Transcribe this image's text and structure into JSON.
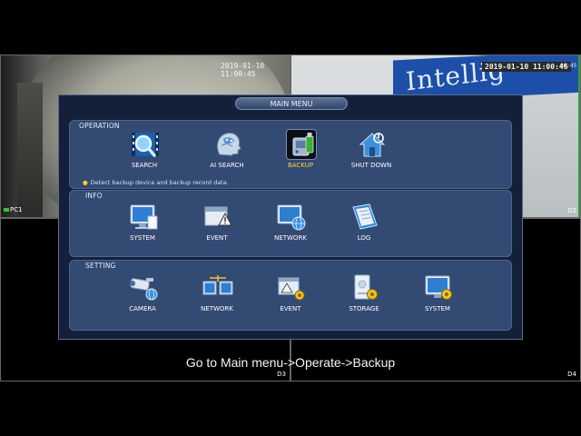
{
  "tiles": {
    "tile1": {
      "timestamp": "2019-01-10 11:00:45",
      "channel": "PC1",
      "rec_color": "#38c238"
    },
    "tile2": {
      "timestamp": "2019-01-10 11:00:46",
      "timestamp_tail": "00:45",
      "banner_text": "Intellig",
      "channel": "D2"
    },
    "tile3": {
      "channel": "D3"
    },
    "tile4": {
      "channel": "D4"
    }
  },
  "menu": {
    "title": "MAIN MENU",
    "sections": {
      "operation": {
        "label": "OPERATION",
        "items": [
          {
            "label": "SEARCH",
            "icon": "search-film-icon"
          },
          {
            "label": "AI SEARCH",
            "icon": "ai-head-icon"
          },
          {
            "label": "BACKUP",
            "icon": "backup-usb-icon",
            "selected": true
          },
          {
            "label": "SHUT DOWN",
            "icon": "shutdown-house-icon"
          }
        ],
        "hint": "Detect backup device and backup record data."
      },
      "info": {
        "label": "INFO",
        "items": [
          {
            "label": "SYSTEM",
            "icon": "system-monitor-icon"
          },
          {
            "label": "EVENT",
            "icon": "event-alarm-icon"
          },
          {
            "label": "NETWORK",
            "icon": "network-globe-icon"
          },
          {
            "label": "LOG",
            "icon": "log-book-icon"
          }
        ]
      },
      "setting": {
        "label": "SETTING",
        "items": [
          {
            "label": "CAMERA",
            "icon": "camera-icon"
          },
          {
            "label": "NETWORK",
            "icon": "network-screens-icon"
          },
          {
            "label": "EVENT",
            "icon": "event-gear-icon"
          },
          {
            "label": "STORAGE",
            "icon": "storage-gear-icon"
          },
          {
            "label": "SYSTEM",
            "icon": "system-gear-icon"
          }
        ]
      }
    }
  },
  "caption": "Go to Main menu->Operate->Backup",
  "colors": {
    "menu_bg": "#14203a",
    "section_bg": "#334a73",
    "selected_label": "#f5d33a"
  }
}
